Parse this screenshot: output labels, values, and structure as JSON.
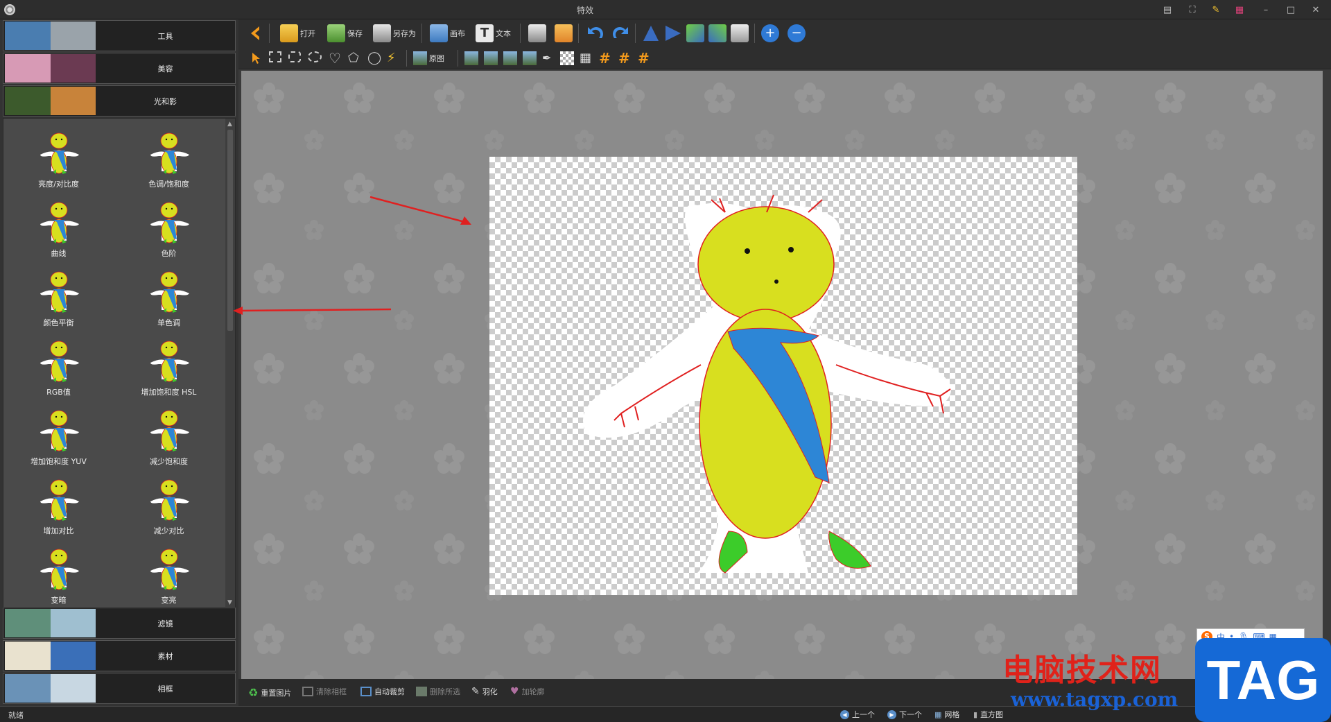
{
  "window": {
    "title": "特效"
  },
  "categories_top": [
    {
      "label": "工具",
      "colors": [
        "#4a7db0",
        "#9aa3aa"
      ]
    },
    {
      "label": "美容",
      "colors": [
        "#d79ab5",
        "#6b3a52"
      ]
    },
    {
      "label": "光和影",
      "colors": [
        "#3c5a2c",
        "#c8833a"
      ]
    }
  ],
  "categories_bottom": [
    {
      "label": "滤镜",
      "colors": [
        "#5f8f7a",
        "#9fbfd0"
      ]
    },
    {
      "label": "素材",
      "colors": [
        "#e9e2cf",
        "#3a6fb8"
      ]
    },
    {
      "label": "相框",
      "colors": [
        "#6a92b7",
        "#c8d7e2"
      ]
    }
  ],
  "effects": [
    {
      "label": "亮度/对比度"
    },
    {
      "label": "色调/饱和度"
    },
    {
      "label": "曲线"
    },
    {
      "label": "色阶"
    },
    {
      "label": "颜色平衡"
    },
    {
      "label": "单色调"
    },
    {
      "label": "RGB值"
    },
    {
      "label": "增加饱和度 HSL"
    },
    {
      "label": "增加饱和度 YUV"
    },
    {
      "label": "减少饱和度"
    },
    {
      "label": "增加对比"
    },
    {
      "label": "减少对比"
    },
    {
      "label": "变暗"
    },
    {
      "label": "变亮"
    }
  ],
  "toolbar": {
    "open": "打开",
    "save": "保存",
    "save_as": "另存为",
    "canvas": "画布",
    "text": "文本",
    "original": "原图"
  },
  "bottom_tools": {
    "reset": "重置图片",
    "clear_frame": "清除相框",
    "auto_crop": "自动裁剪",
    "delete_selection": "删除所选",
    "feather": "羽化",
    "add_outline": "加轮廓"
  },
  "statusbar": {
    "status": "就绪",
    "prev": "上一个",
    "next": "下一个",
    "grid": "网格",
    "histogram": "直方图"
  },
  "watermark": {
    "site_name": "电脑技术网",
    "url": "www.tagxp.com",
    "tag": "TAG"
  },
  "ime": {
    "lang": "中"
  },
  "colors": {
    "arrow": "#e02020",
    "figure_yellow": "#d8df1f",
    "figure_blue": "#2d86d6",
    "feet_green": "#3ccc2a"
  }
}
